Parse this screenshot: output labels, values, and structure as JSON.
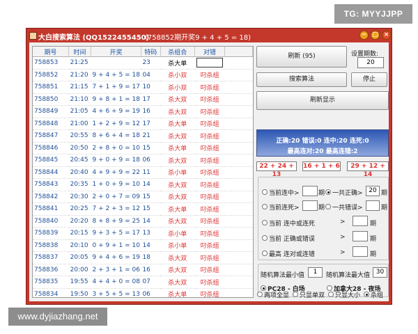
{
  "watermark_top": "TG: MYYJJPP",
  "watermark_bottom": "www.dyjiazhang.net",
  "window": {
    "title": "大白搜索算法 (QQ1522455450)",
    "info": "(758852期开奖9 + 4 + 5 = 18)",
    "min_icon": "−",
    "max_icon": "□",
    "close_icon": "×"
  },
  "table": {
    "headers": [
      "期号",
      "时间",
      "开奖",
      "特码",
      "杀组合",
      "对错"
    ],
    "rows": [
      [
        "758853",
        "21:25",
        "",
        "23",
        "杀大单",
        ""
      ],
      [
        "758852",
        "21:20",
        "9 + 4 + 5 = 18",
        "04",
        "杀小双",
        "叼杀组"
      ],
      [
        "758851",
        "21:15",
        "7 + 1 + 9 = 17",
        "10",
        "杀小双",
        "叼杀组"
      ],
      [
        "758850",
        "21:10",
        "9 + 8 + 1 = 18",
        "17",
        "杀大双",
        "叼杀组"
      ],
      [
        "758849",
        "21:05",
        "4 + 6 + 9 = 19",
        "16",
        "杀大双",
        "叼杀组"
      ],
      [
        "758848",
        "21:00",
        "1 + 2 + 9 = 12",
        "17",
        "杀大单",
        "叼杀组"
      ],
      [
        "758847",
        "20:55",
        "8 + 6 + 4 = 18",
        "21",
        "杀大双",
        "叼杀组"
      ],
      [
        "758846",
        "20:50",
        "2 + 8 + 0 = 10",
        "15",
        "杀大单",
        "叼杀组"
      ],
      [
        "758845",
        "20:45",
        "9 + 0 + 9 = 18",
        "06",
        "杀大双",
        "叼杀组"
      ],
      [
        "758844",
        "20:40",
        "4 + 9 + 9 = 22",
        "11",
        "杀小单",
        "叼杀组"
      ],
      [
        "758843",
        "20:35",
        "1 + 0 + 9 = 10",
        "14",
        "杀大双",
        "叼杀组"
      ],
      [
        "758842",
        "20:30",
        "2 + 0 + 7 = 09",
        "15",
        "杀大双",
        "叼杀组"
      ],
      [
        "758841",
        "20:25",
        "7 + 2 + 3 = 12",
        "15",
        "杀大单",
        "叼杀组"
      ],
      [
        "758840",
        "20:20",
        "8 + 8 + 9 = 25",
        "14",
        "杀大双",
        "叼杀组"
      ],
      [
        "758839",
        "20:15",
        "9 + 3 + 5 = 17",
        "13",
        "杀小单",
        "叼杀组"
      ],
      [
        "758838",
        "20:10",
        "0 + 9 + 1 = 10",
        "14",
        "杀小单",
        "叼杀组"
      ],
      [
        "758837",
        "20:05",
        "9 + 4 + 6 = 19",
        "18",
        "杀大双",
        "叼杀组"
      ],
      [
        "758836",
        "20:00",
        "2 + 3 + 1 = 06",
        "16",
        "杀大双",
        "叼杀组"
      ],
      [
        "758835",
        "19:55",
        "4 + 4 + 0 = 08",
        "07",
        "杀大双",
        "叼杀组"
      ],
      [
        "758834",
        "19:50",
        "3 + 5 + 5 = 13",
        "06",
        "杀大单",
        "叼杀组"
      ],
      [
        "758833",
        "19:45",
        "0 + 5 + 0 = 05",
        "06",
        "杀大双",
        "叼杀组"
      ]
    ]
  },
  "controls": {
    "refresh_button": "刷新 (95)",
    "periods_label": "设置期数:",
    "periods_value": "20",
    "search_button": "搜索算法",
    "stop_button": "停止",
    "refresh_display_button": "刷新显示",
    "status_line1": "正确:20 错误:0 连中:20 连死:0",
    "status_line2": "最高连对:20 最高连错:2",
    "sum1": "22 + 24 + 13",
    "sum2": "16 + 1 + 6",
    "sum3": "29 + 12 + 14",
    "opt_current_win": "当前连中",
    "opt_total_correct": "一共正确",
    "total_correct_value": "20",
    "opt_current_loss": "当前连死",
    "opt_total_wrong": "一共错误",
    "opt_cur_win_or_loss": "当前 连中或连死",
    "opt_cur_correct_or_wrong": "当前 正确或错误",
    "opt_max_correct_or_wrong": "最高 连对或连错",
    "gt": ">",
    "period_unit": "期",
    "rand_min_label": "随机算法最小值",
    "rand_min_value": "1",
    "rand_max_label": "随机算法最大值",
    "rand_max_value": "30",
    "pc28_label": "PC28 - 白场",
    "jnd_label": "加拿大28 - 夜场",
    "filter_all": "两项全显",
    "filter_single_double": "只显单双",
    "filter_big_small": "只显大小",
    "filter_kill": "杀组"
  },
  "colors": {
    "window_frame": "#c4372b",
    "header_text": "#1f58a8",
    "red_text": "#d33333",
    "status_top": "#2d57b4"
  }
}
